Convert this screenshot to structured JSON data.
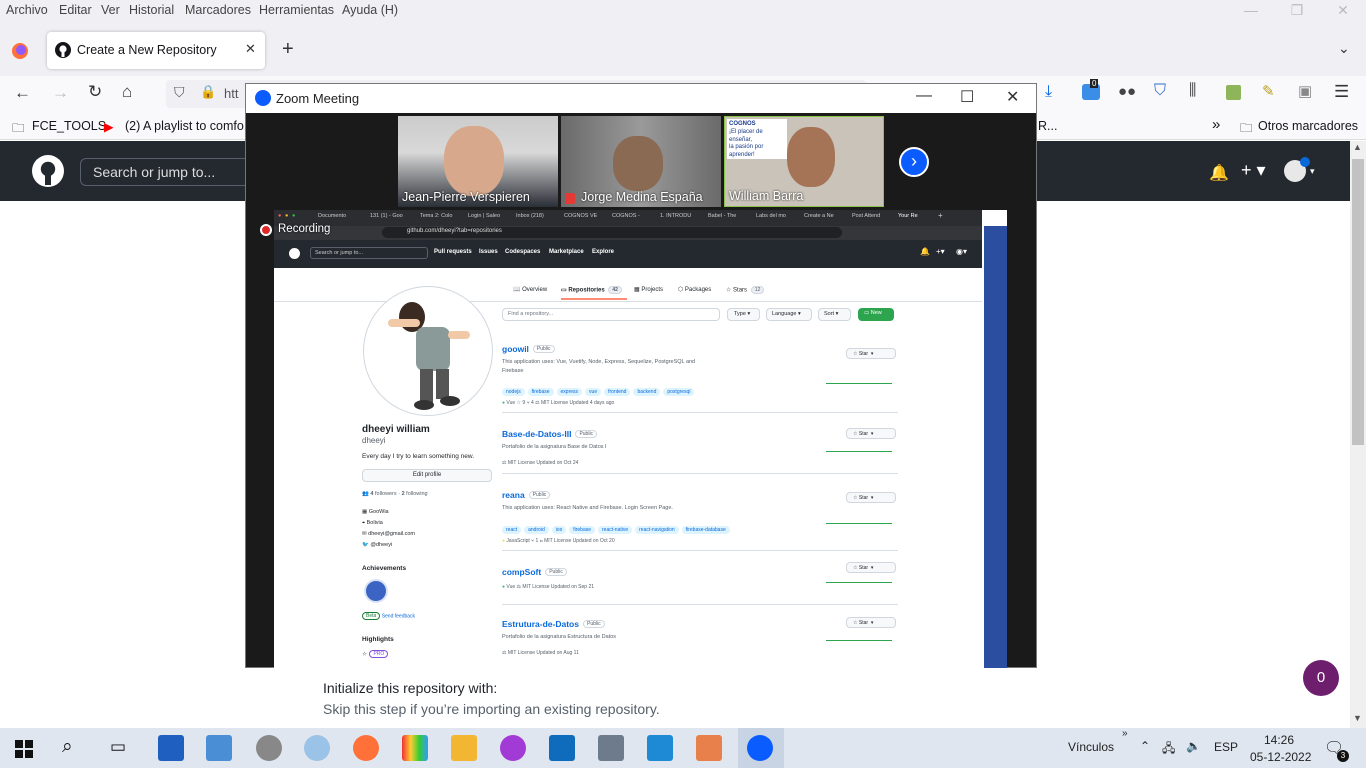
{
  "menu": [
    "Archivo",
    "Editar",
    "Ver",
    "Historial",
    "Marcadores",
    "Herramientas",
    "Ayuda (H)"
  ],
  "browser": {
    "tab_title": "Create a New Repository",
    "url_partial": "htt",
    "bookmarks": [
      "FCE_TOOLS",
      "(2) A playlist to comfo...",
      "R...",
      "Otros marcadores"
    ],
    "badge_count": "0"
  },
  "github": {
    "search_placeholder": "Search or jump to...",
    "init_heading": "Initialize this repository with:",
    "init_sub": "Skip this step if you’re importing an existing repository.",
    "notification_count": "0"
  },
  "zoom": {
    "title": "Zoom Meeting",
    "participants": [
      "Jean-Pierre Verspieren",
      "Jorge Medina España",
      "William Barra"
    ],
    "recording_label": "Recording",
    "slide_text": [
      "COGNOS",
      "¡El placer de enseñar,",
      "la pasión por aprender!"
    ]
  },
  "shared_screen": {
    "tabs": [
      "Documento",
      "131 (1) - Goo",
      "Tema 2: Colo",
      "Login | Saleo",
      "Inbox (218)",
      "COGNOS VE",
      "COGNOS -",
      "1. INTRODU",
      "Babel - The",
      "Labs del mo",
      "Create a Ne",
      "Post Attend",
      "Your Re"
    ],
    "url": "github.com/dheeyi?tab=repositories",
    "nav": [
      "Pull requests",
      "Issues",
      "Codespaces",
      "Marketplace",
      "Explore"
    ],
    "search": "Search or jump to...",
    "profile_tabs": [
      {
        "label": "Overview",
        "count": ""
      },
      {
        "label": "Repositories",
        "count": "42"
      },
      {
        "label": "Projects",
        "count": ""
      },
      {
        "label": "Packages",
        "count": ""
      },
      {
        "label": "Stars",
        "count": "12"
      }
    ],
    "find_placeholder": "Find a repository...",
    "filters": [
      "Type",
      "Language",
      "Sort"
    ],
    "new_button": "New",
    "profile": {
      "name": "dheeyi william",
      "login": "dheeyi",
      "bio": "Every day I try to learn something new.",
      "edit": "Edit profile",
      "followers_n": "4",
      "followers_label": "followers",
      "following_n": "2",
      "following_label": "following",
      "details": [
        "GooWia",
        "Bolivia",
        "dheeyi@gmail.com",
        "@dheeyi"
      ],
      "achievements": "Achievements",
      "beta": "Beta",
      "feedback": "Send feedback",
      "highlights": "Highlights",
      "pro": "PRO"
    },
    "repos": [
      {
        "name": "goowil",
        "vis": "Public",
        "desc": "This application uses: Vue, Vuetify, Node, Express, Sequelize, PostgreSQL and Firebase",
        "topics": [
          "nodejs",
          "firebase",
          "express",
          "vue",
          "frontend",
          "backend",
          "postgresql"
        ],
        "meta": "Vue   ☆ 9   ⑂ 4   ⚖ MIT License   Updated 4 days ago",
        "lang_color": "#41b883"
      },
      {
        "name": "Base-de-Datos-III",
        "vis": "Public",
        "desc": "Portafolio de la asignatura Base de Datos I",
        "topics": [],
        "meta": "⚖ MIT License   Updated on Oct 24",
        "lang_color": ""
      },
      {
        "name": "reana",
        "vis": "Public",
        "desc": "This application uses: React Native and Firebase. Login Screen Page.",
        "topics": [
          "react",
          "android",
          "ios",
          "firebase",
          "react-native",
          "react-navigation",
          "firebase-database"
        ],
        "meta": "JavaScript   ⑂ 1   ⚖ MIT License   Updated on Oct 20",
        "lang_color": "#f1e05a"
      },
      {
        "name": "compSoft",
        "vis": "Public",
        "desc": "",
        "topics": [],
        "meta": "Vue   ⚖ MIT License   Updated on Sep 21",
        "lang_color": "#41b883"
      },
      {
        "name": "Estrutura-de-Datos",
        "vis": "Public",
        "desc": "Portafolio de la asignatura Estructura de Datos",
        "topics": [],
        "meta": "⚖ MIT License   Updated on Aug 11",
        "lang_color": ""
      }
    ],
    "star_label": "Star"
  },
  "taskbar": {
    "vinculos": "Vínculos",
    "lang": "ESP",
    "time": "14:26",
    "date": "05-12-2022",
    "notif": "3"
  },
  "colors": {
    "zoom_blue": "#0b5cff",
    "github_dark": "#24292f",
    "new_green": "#2da44e",
    "dock_blue": "#2b4ea0",
    "record_red": "#e02828"
  }
}
